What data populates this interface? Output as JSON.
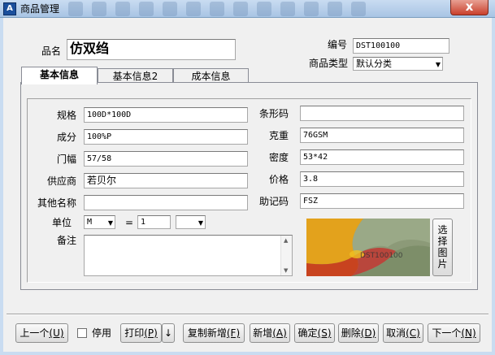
{
  "window": {
    "title": "商品管理",
    "close_glyph": "x",
    "app_icon_glyph": "A"
  },
  "header": {
    "name_label": "品名",
    "name_value": "仿双绉",
    "code_label": "编号",
    "code_value": "DST100100",
    "type_label": "商品类型",
    "type_value": "默认分类"
  },
  "tabs": [
    {
      "label": "基本信息"
    },
    {
      "label": "基本信息2"
    },
    {
      "label": "成本信息"
    }
  ],
  "fields": {
    "spec": {
      "label": "规格",
      "value": "100D*100D"
    },
    "barcode": {
      "label": "条形码",
      "value": ""
    },
    "composition": {
      "label": "成分",
      "value": "100%P"
    },
    "weight": {
      "label": "克重",
      "value": "76GSM"
    },
    "width": {
      "label": "门幅",
      "value": "57/58"
    },
    "density": {
      "label": "密度",
      "value": "53*42"
    },
    "supplier": {
      "label": "供应商",
      "value": "若贝尔"
    },
    "price": {
      "label": "价格",
      "value": "3.8"
    },
    "other_name": {
      "label": "其他名称",
      "value": ""
    },
    "mnemonic": {
      "label": "助记码",
      "value": "FSZ"
    },
    "unit": {
      "label": "单位",
      "value": "M",
      "equals": "=",
      "qty": "1",
      "unit2": ""
    },
    "remark": {
      "label": "备注",
      "value": ""
    }
  },
  "photo": {
    "button_label": "选择图片",
    "caption": "DST100100"
  },
  "buttons": {
    "prev": {
      "label": "上一个",
      "hotkey": "(U)"
    },
    "disable": {
      "label": "停用"
    },
    "print": {
      "label": "打印",
      "hotkey": "(P)",
      "arrow": "↓"
    },
    "copy_new": {
      "label": "复制新增",
      "hotkey": "(F)"
    },
    "new": {
      "label": "新增",
      "hotkey": "(A)"
    },
    "ok": {
      "label": "确定",
      "hotkey": "(S)"
    },
    "delete": {
      "label": "删除",
      "hotkey": "(D)"
    },
    "cancel": {
      "label": "取消",
      "hotkey": "(C)"
    },
    "next": {
      "label": "下一个",
      "hotkey": "(N)"
    }
  },
  "icons": {
    "dropdown": "▼",
    "scroll_up": "▲",
    "scroll_down": "▼"
  },
  "colors": {
    "title_bar": "#b7cfeb",
    "close": "#c9402c",
    "panel": "#f0f0f0"
  }
}
